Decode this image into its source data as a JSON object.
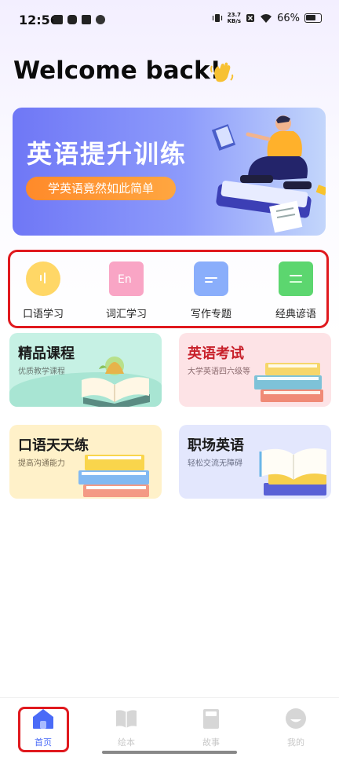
{
  "status_bar": {
    "time": "12:56",
    "net_speed_value": "23.7",
    "net_speed_unit": "KB/s",
    "battery_percent": "66%"
  },
  "welcome": {
    "title": "Welcome back!",
    "wave_icon": "waving-hand-icon"
  },
  "banner": {
    "title": "英语提升训练",
    "button_label": "学英语竟然如此简单",
    "colors": {
      "gradient_start": "#6f77f6",
      "gradient_end": "#c3d6fb",
      "button": "#ff8a2a"
    }
  },
  "categories": [
    {
      "label": "口语学习",
      "icon": "speech-bubble-icon",
      "color": "#ffc94a"
    },
    {
      "label": "词汇学习",
      "icon": "en-book-icon",
      "color": "#f58bb1"
    },
    {
      "label": "写作专题",
      "icon": "document-icon",
      "color": "#6e96f8"
    },
    {
      "label": "经典谚语",
      "icon": "green-book-icon",
      "color": "#52d06a"
    }
  ],
  "cards": [
    {
      "title": "精品课程",
      "subtitle": "优质教学课程",
      "bg": "#c6f1e4",
      "title_color": "#1a1a1a",
      "sub_color": "#6b7a74"
    },
    {
      "title": "英语考试",
      "subtitle": "大学英语四六级等",
      "bg": "#fde3e6",
      "title_color": "#c8212b",
      "sub_color": "#8b6a6e"
    },
    {
      "title": "口语天天练",
      "subtitle": "提高沟通能力",
      "bg": "#fff1c9",
      "title_color": "#1a1a1a",
      "sub_color": "#7a6d55"
    },
    {
      "title": "职场英语",
      "subtitle": "轻松交流无障碍",
      "bg": "#e3e7fd",
      "title_color": "#1a1a1a",
      "sub_color": "#6a6f86"
    }
  ],
  "tabs": [
    {
      "label": "首页",
      "icon": "home-icon",
      "active": true
    },
    {
      "label": "绘本",
      "icon": "open-book-icon",
      "active": false
    },
    {
      "label": "故事",
      "icon": "book-icon",
      "active": false
    },
    {
      "label": "我的",
      "icon": "profile-icon",
      "active": false
    }
  ]
}
